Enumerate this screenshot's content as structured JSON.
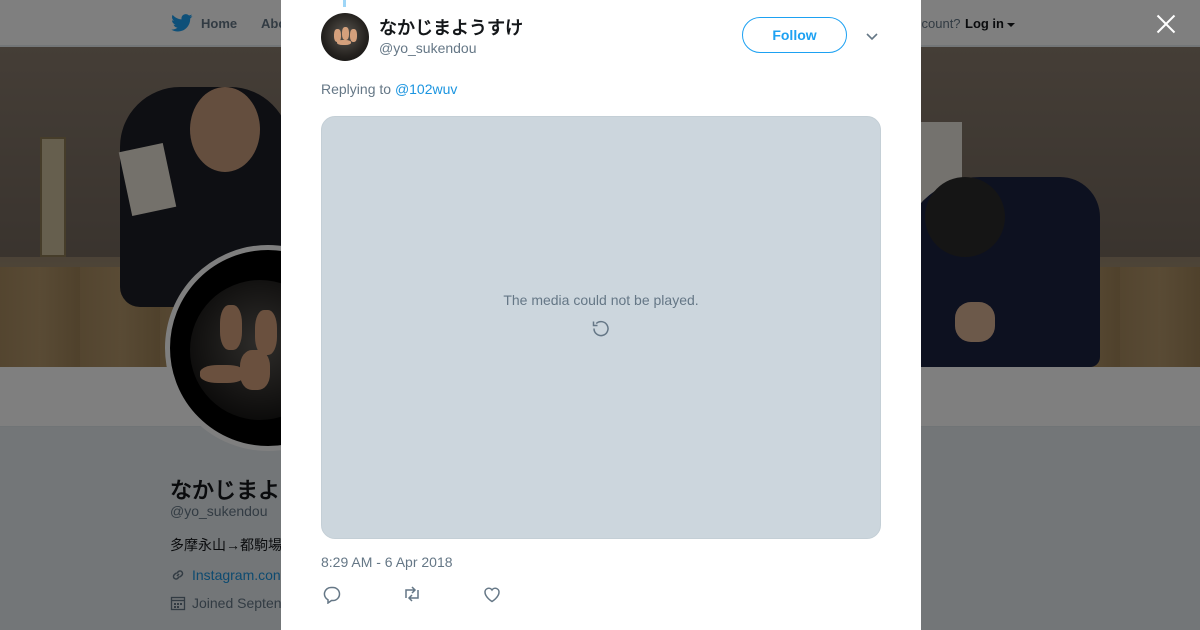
{
  "nav": {
    "home_label": "Home",
    "about_label": "Abo",
    "account_prompt": "ccount?",
    "login_label": "Log in"
  },
  "profile": {
    "name": "なかじまよ",
    "handle": "@yo_sukendou",
    "bio": "多摩永山→都駒場",
    "link": "Instagram.con",
    "joined": "Joined Septen"
  },
  "tweet": {
    "author_name": "なかじまようすけ",
    "author_handle": "@yo_sukendou",
    "follow_label": "Follow",
    "replying_prefix": "Replying to",
    "replying_to": "@102wuv",
    "media_error": "The media could not be played.",
    "timestamp": "8:29 AM - 6 Apr 2018"
  },
  "icons": {
    "brand": "twitter-bird-icon",
    "close": "close-icon",
    "caret": "chevron-down-icon",
    "retry": "retry-icon",
    "reply": "reply-icon",
    "retweet": "retweet-icon",
    "like": "heart-icon",
    "link": "link-icon",
    "calendar": "calendar-icon"
  },
  "colors": {
    "accent": "#1da1f2",
    "link": "#1b95e0",
    "muted": "#657786",
    "media_bg": "#ccd6dd"
  }
}
